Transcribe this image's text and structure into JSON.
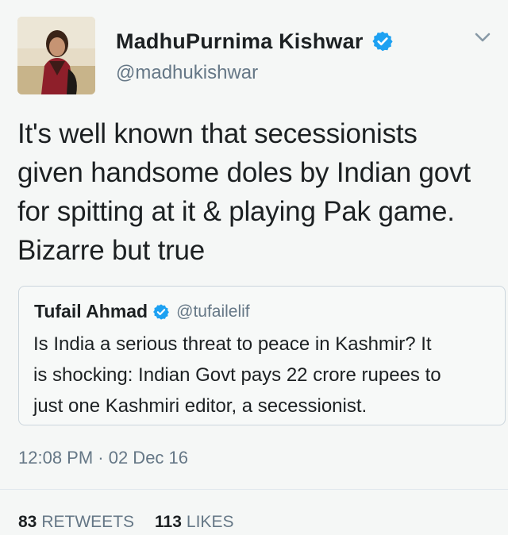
{
  "author": {
    "name": "MadhuPurnima Kishwar",
    "handle": "@madhukishwar"
  },
  "tweet": {
    "text": "It's well known that secessionists\ngiven handsome doles by Indian govt\nfor spitting at it & playing Pak game.\nBizarre but true",
    "timestamp": "12:08 PM · 02 Dec 16"
  },
  "quoted": {
    "name": "Tufail Ahmad",
    "handle": "@tufailelif",
    "text": "Is India a serious threat to peace in Kashmir? It\nis shocking: Indian Govt pays 22 crore rupees to\njust one Kashmiri editor, a secessionist."
  },
  "stats": {
    "retweets_count": "83",
    "retweets_label": "RETWEETS",
    "likes_count": "113",
    "likes_label": "LIKES"
  },
  "icons": {
    "verified": "verified-badge-icon",
    "menu": "chevron-down-icon"
  },
  "colors": {
    "verified_blue": "#1da1f2",
    "secondary_text": "#657786",
    "text": "#1c2022",
    "border": "#ccd6dd"
  }
}
